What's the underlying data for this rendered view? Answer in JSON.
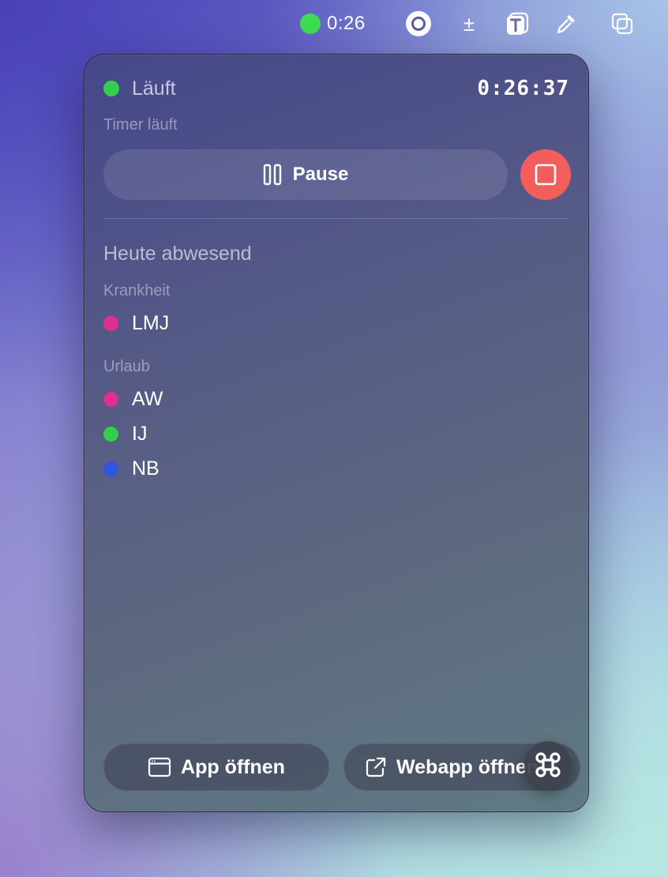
{
  "menubar": {
    "timer_text": "0:26",
    "status_color": "#3ddc52",
    "icons": [
      "record-icon",
      "plus-minus-icon",
      "text-t-icon",
      "eyedropper-icon",
      "copy-windows-icon"
    ],
    "plus_minus_glyph": "±"
  },
  "panel": {
    "status_label": "Läuft",
    "elapsed": "0:26:37",
    "timer_subtitle": "Timer läuft",
    "pause_label": "Pause",
    "stop_color": "#f25e5c",
    "absent_title": "Heute abwesend",
    "categories": [
      {
        "label": "Krankheit",
        "people": [
          {
            "name": "LMJ",
            "color": "#e0308e"
          }
        ]
      },
      {
        "label": "Urlaub",
        "people": [
          {
            "name": "AW",
            "color": "#e0308e"
          },
          {
            "name": "IJ",
            "color": "#33cf4c"
          },
          {
            "name": "NB",
            "color": "#2f56e0"
          }
        ]
      }
    ],
    "app_button_label": "App öffnen",
    "webapp_button_label": "Webapp öffnen"
  }
}
